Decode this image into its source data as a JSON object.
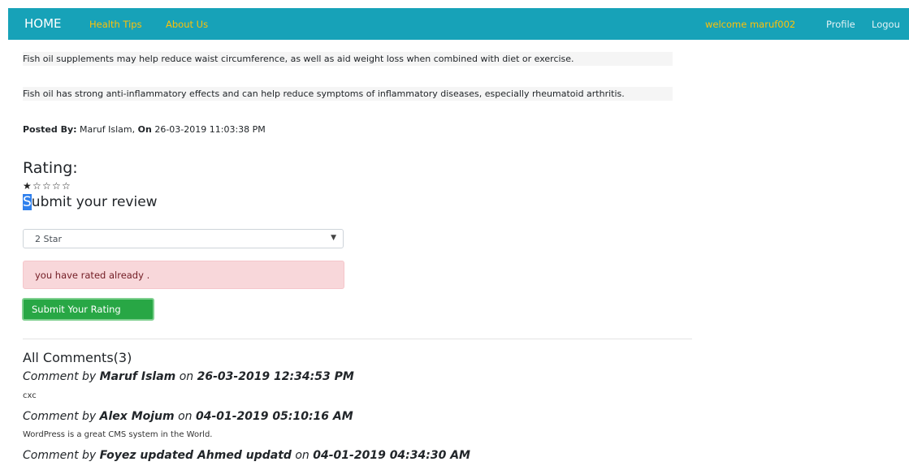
{
  "navbar": {
    "home": "HOME",
    "health_tips": "Health Tips",
    "about_us": "About Us",
    "welcome": "welcome maruf002",
    "profile": "Profile",
    "logout": "Logou"
  },
  "post": {
    "paragraphs": [
      "Fish oil supplements may help reduce waist circumference, as well as aid weight loss when combined with diet or exercise.",
      "Fish oil has strong anti-inflammatory effects and can help reduce symptoms of inflammatory diseases, especially rheumatoid arthritis."
    ],
    "posted_by_label": "Posted By:",
    "author": "Maruf Islam,",
    "on_label": "On",
    "date": "26-03-2019 11:03:38 PM"
  },
  "rating": {
    "heading": "Rating:",
    "stars_filled": 1,
    "stars_total": 5,
    "filled_glyph": "★",
    "empty_glyph": "☆"
  },
  "review": {
    "heading_first": "S",
    "heading_rest": "ubmit your review",
    "selected_option": "2 Star",
    "alert": "you have rated already .",
    "submit_label": "Submit Your Rating"
  },
  "comments": {
    "heading": "All Comments(3)",
    "by_label": "Comment by",
    "on_label": "on",
    "items": [
      {
        "author": "Maruf Islam",
        "date": "26-03-2019 12:34:53 PM",
        "text": "cxc"
      },
      {
        "author": "Alex Mojum",
        "date": "04-01-2019 05:10:16 AM",
        "text": "WordPress is a great CMS system in the World."
      },
      {
        "author": "Foyez updated Ahmed updatd",
        "date": "04-01-2019 04:34:30 AM",
        "text": ""
      }
    ]
  },
  "colors": {
    "navbar_bg": "#17a2b8",
    "nav_accent": "#ffc107",
    "alert_bg": "#f8d7da",
    "button_bg": "#28a745"
  }
}
